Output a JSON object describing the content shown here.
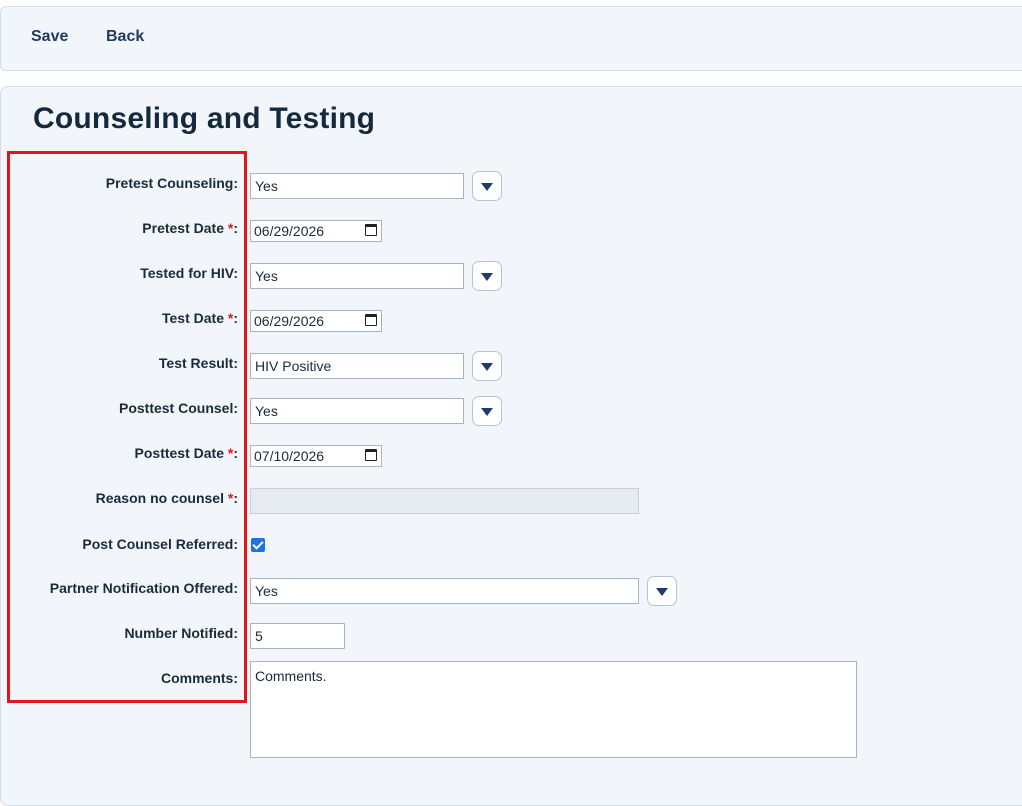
{
  "toolbar": {
    "save_label": "Save",
    "back_label": "Back"
  },
  "page": {
    "title": "Counseling and Testing"
  },
  "form": {
    "pretest_counseling": {
      "label": "Pretest Counseling:",
      "value": "Yes"
    },
    "pretest_date": {
      "label": "Pretest Date",
      "required_mark": "*",
      "suffix": ":",
      "value": "06/29/2026"
    },
    "tested_for_hiv": {
      "label": "Tested for HIV:",
      "value": "Yes"
    },
    "test_date": {
      "label": "Test Date",
      "required_mark": "*",
      "suffix": ":",
      "value": "06/29/2026"
    },
    "test_result": {
      "label": "Test Result:",
      "value": "HIV Positive"
    },
    "posttest_counsel": {
      "label": "Posttest Counsel:",
      "value": "Yes"
    },
    "posttest_date": {
      "label": "Posttest Date",
      "required_mark": "*",
      "suffix": ":",
      "value": "07/10/2026"
    },
    "reason_no_counsel": {
      "label": "Reason no counsel",
      "required_mark": "*",
      "suffix": ":",
      "value": ""
    },
    "post_counsel_referred": {
      "label": "Post Counsel Referred:",
      "checked": true
    },
    "partner_notification_offered": {
      "label": "Partner Notification Offered:",
      "value": "Yes"
    },
    "number_notified": {
      "label": "Number Notified:",
      "value": "5"
    },
    "comments": {
      "label": "Comments:",
      "value": "Comments."
    }
  },
  "icons": {
    "dropdown": "caret-down-icon",
    "calendar": "calendar-icon",
    "checkbox": "checkmark-icon"
  },
  "colors": {
    "highlight_border": "#e0161d",
    "dropdown_caret": "#1f3a6b",
    "checkbox_fill": "#1a73e8",
    "required_mark": "#e0161d"
  }
}
